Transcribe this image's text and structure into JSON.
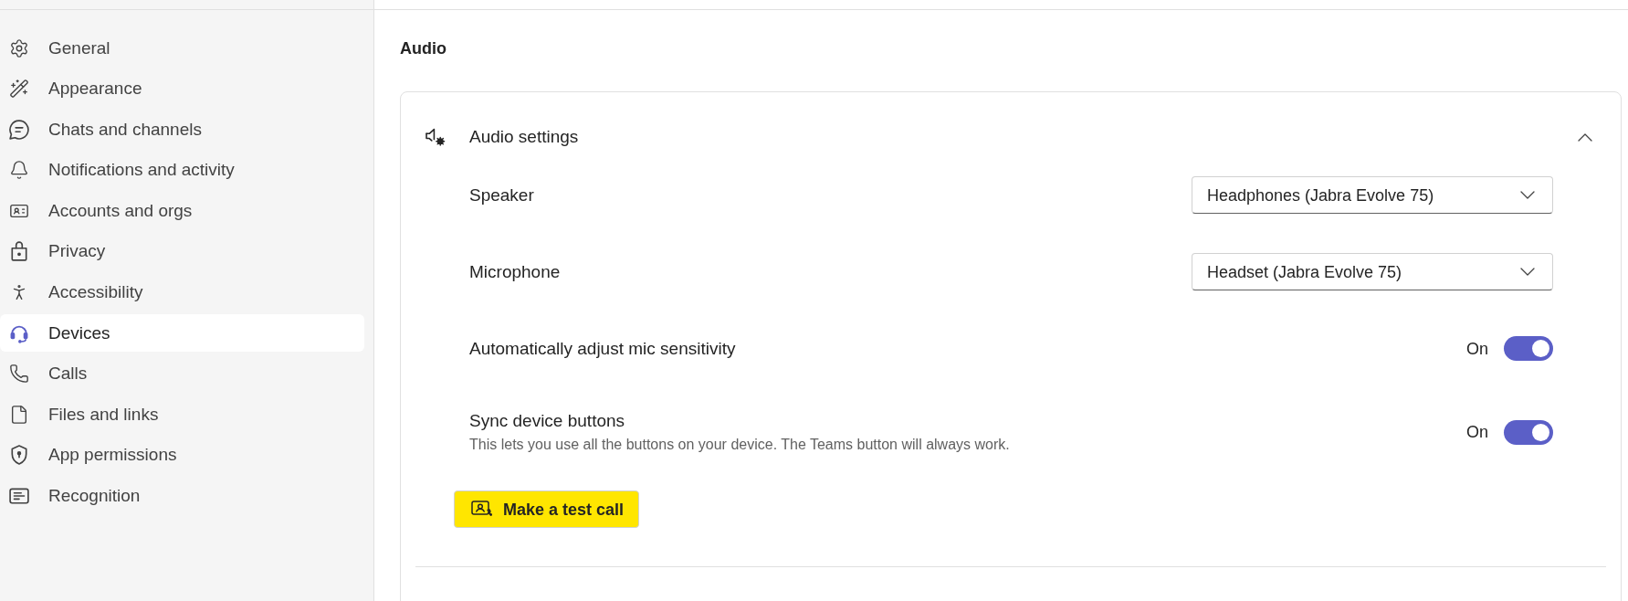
{
  "sidebar": {
    "items": [
      {
        "label": "General",
        "selected": false
      },
      {
        "label": "Appearance",
        "selected": false
      },
      {
        "label": "Chats and channels",
        "selected": false
      },
      {
        "label": "Notifications and activity",
        "selected": false
      },
      {
        "label": "Accounts and orgs",
        "selected": false
      },
      {
        "label": "Privacy",
        "selected": false
      },
      {
        "label": "Accessibility",
        "selected": false
      },
      {
        "label": "Devices",
        "selected": true
      },
      {
        "label": "Calls",
        "selected": false
      },
      {
        "label": "Files and links",
        "selected": false
      },
      {
        "label": "App permissions",
        "selected": false
      },
      {
        "label": "Recognition",
        "selected": false
      }
    ]
  },
  "section_title": "Audio",
  "audio_settings": {
    "title": "Audio settings",
    "expanded": true,
    "rows": [
      {
        "kind": "dropdown",
        "label": "Speaker",
        "value": "Headphones (Jabra Evolve 75)"
      },
      {
        "kind": "dropdown",
        "label": "Microphone",
        "value": "Headset (Jabra Evolve 75)"
      },
      {
        "kind": "toggle",
        "label": "Automatically adjust mic sensitivity",
        "state_label": "On",
        "on": true
      },
      {
        "kind": "toggle",
        "label": "Sync device buttons",
        "description": "This lets you use all the buttons on your device. The Teams button will always work.",
        "state_label": "On",
        "on": true
      }
    ],
    "test_call_button": {
      "label": "Make a test call",
      "highlighted": true
    }
  }
}
